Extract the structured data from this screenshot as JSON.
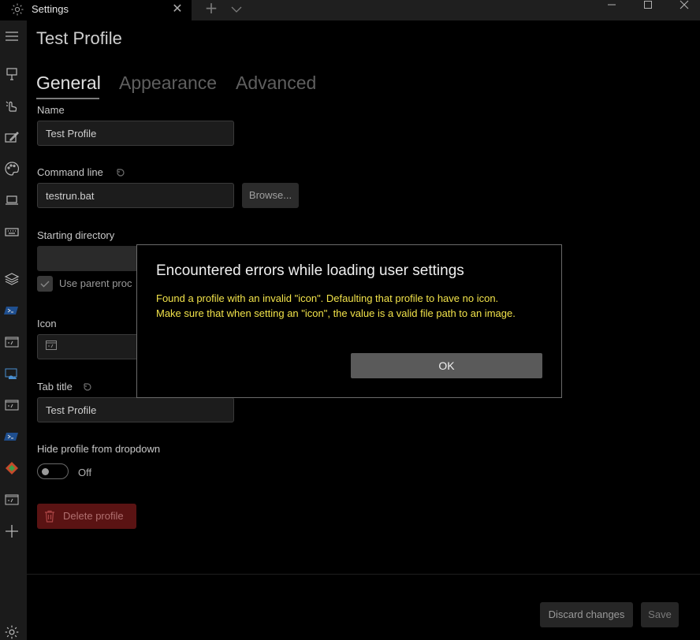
{
  "window": {
    "tab_title": "Settings",
    "close_tab": "✕",
    "new_tab": "+"
  },
  "page": {
    "title": "Test Profile",
    "tabs": [
      {
        "label": "General"
      },
      {
        "label": "Appearance"
      },
      {
        "label": "Advanced"
      }
    ]
  },
  "form": {
    "name_label": "Name",
    "name_value": "Test Profile",
    "command_line_label": "Command line",
    "command_line_value": "testrun.bat",
    "browse_label": "Browse...",
    "starting_dir_label": "Starting directory",
    "starting_dir_value": "",
    "use_parent_label": "Use parent proc",
    "icon_label": "Icon",
    "tab_title_label": "Tab title",
    "tab_title_value": "Test Profile",
    "hide_profile_label": "Hide profile from dropdown",
    "toggle_state": "Off",
    "delete_label": "Delete profile"
  },
  "footer": {
    "discard_label": "Discard changes",
    "save_label": "Save"
  },
  "dialog": {
    "title": "Encountered errors while loading user settings",
    "message_line1": "Found a profile with an invalid \"icon\". Defaulting that profile to have no icon.",
    "message_line2": "Make sure that when setting an \"icon\", the value is a valid file path to an image.",
    "ok_label": "OK"
  },
  "colors": {
    "dialog_message": "#f2e34a",
    "delete_button": "#5a1313"
  }
}
